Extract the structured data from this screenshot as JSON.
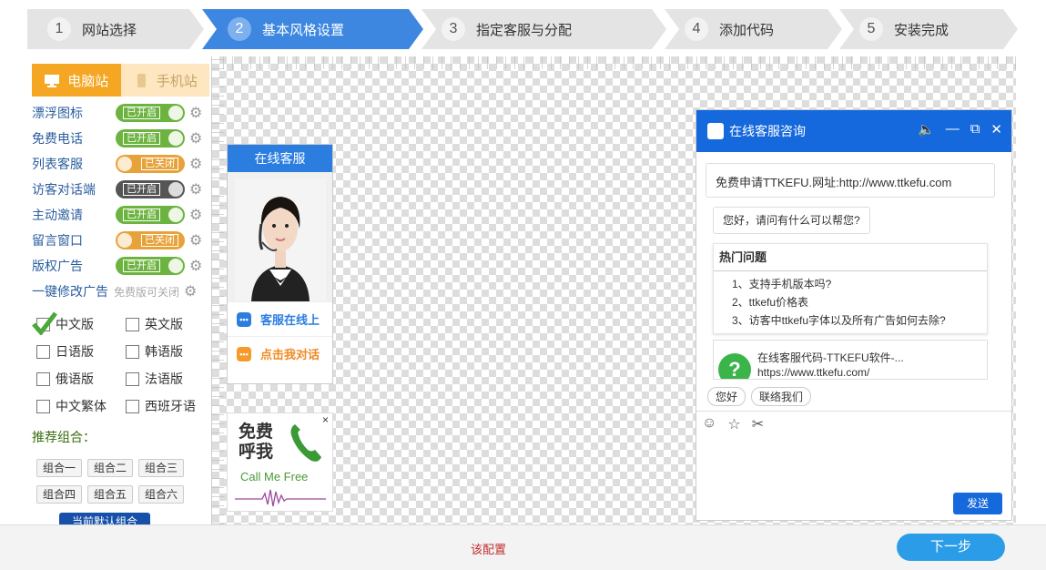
{
  "steps": [
    {
      "num": "1",
      "label": "网站选择"
    },
    {
      "num": "2",
      "label": "基本风格设置"
    },
    {
      "num": "3",
      "label": "指定客服与分配"
    },
    {
      "num": "4",
      "label": "添加代码"
    },
    {
      "num": "5",
      "label": "安装完成"
    }
  ],
  "site_tabs": {
    "pc": "电脑站",
    "mobile": "手机站"
  },
  "features": [
    {
      "label": "漂浮图标",
      "state": "已开启"
    },
    {
      "label": "免费电话",
      "state": "已开启"
    },
    {
      "label": "列表客服",
      "state": "已关闭"
    },
    {
      "label": "访客对话端",
      "state": "已开启"
    },
    {
      "label": "主动邀请",
      "state": "已开启"
    },
    {
      "label": "留言窗口",
      "state": "已关闭"
    },
    {
      "label": "版权广告",
      "state": "已开启"
    }
  ],
  "ad_edit": {
    "label": "一键修改广告",
    "note": "免费版可关闭"
  },
  "languages": [
    "中文版",
    "英文版",
    "日语版",
    "韩语版",
    "俄语版",
    "法语版",
    "中文繁体",
    "西班牙语"
  ],
  "recommend_label": "推荐组合：",
  "combos": [
    "组合一",
    "组合二",
    "组合三",
    "组合四",
    "组合五",
    "组合六"
  ],
  "current_default": "当前默认组合",
  "float_panel": {
    "title": "在线客服",
    "row1": "客服在线上",
    "row2": "点击我对话"
  },
  "phone_widget": {
    "line1": "免费",
    "line2": "呼我",
    "sub": "Call Me Free",
    "close": "×"
  },
  "chat": {
    "title": "在线客服咨询",
    "msg1": "免费申请TTKEFU.网址:http://www.ttkefu.com",
    "msg2": "您好，请问有什么可以帮您?",
    "hot_title": "热门问题",
    "questions": [
      "1、支持手机版本吗?",
      "2、ttkefu价格表",
      "3、访客中ttkefu字体以及所有广告如何去除?"
    ],
    "link_title": "在线客服代码-TTKEFU软件-...",
    "link_url": "https://www.ttkefu.com/",
    "quick": [
      "您好",
      "联络我们"
    ],
    "send": "发送"
  },
  "notice": "该配置",
  "next": "下一步",
  "colors": {
    "active_step": "#3d87e0",
    "pc_tab": "#f5a623",
    "toggle_on": "#6cb33f",
    "toggle_off": "#e8a23a",
    "chat_bar": "#1669dc",
    "next": "#2b9de8"
  }
}
